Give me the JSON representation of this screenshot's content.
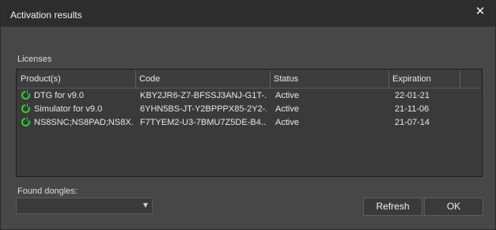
{
  "window": {
    "title": "Activation results"
  },
  "licenses": {
    "label": "Licenses",
    "columns": [
      "Product(s)",
      "Code",
      "Status",
      "Expiration"
    ],
    "rows": [
      {
        "product": "DTG for v9.0",
        "code": "KBY2JR6-Z7-BFSSJ3ANJ-G1T-...",
        "status": "Active",
        "expiration": "22-01-21"
      },
      {
        "product": "Simulator for v9.0",
        "code": "6YHN5BS-JT-Y2BPPPX85-2Y2-...",
        "status": "Active",
        "expiration": "21-11-06"
      },
      {
        "product": "NS8SNC;NS8PAD;NS8X...",
        "code": "F7TYEM2-U3-7BMU7Z5DE-B4...",
        "status": "Active",
        "expiration": "21-07-14"
      }
    ]
  },
  "dongles": {
    "label": "Found dongles:",
    "selected": ""
  },
  "buttons": {
    "refresh": "Refresh",
    "ok": "OK",
    "close": "✕"
  },
  "icons": {
    "status_active": "power-on-icon",
    "dropdown": "chevron-down-icon"
  },
  "colors": {
    "active_icon": "#2fd22f"
  }
}
